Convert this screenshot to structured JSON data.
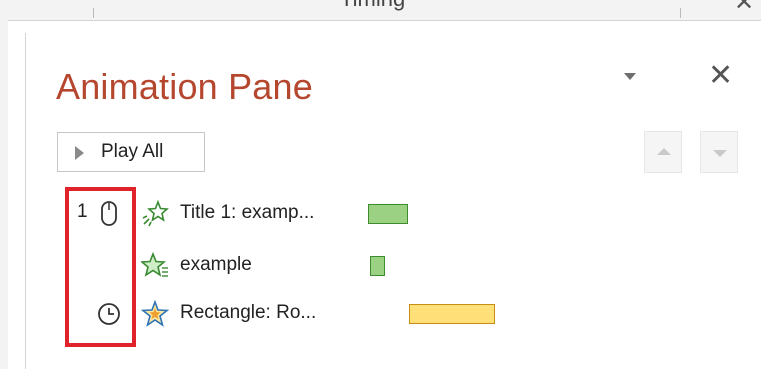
{
  "ribbon": {
    "tab_label": "Timing",
    "close_glyph": "✕"
  },
  "pane": {
    "title": "Animation Pane",
    "close_glyph": "✕",
    "play_all_label": "Play All"
  },
  "animations": [
    {
      "order": "1",
      "trigger": "mouse-click-icon",
      "effect": "entrance-star-icon",
      "name": "Title 1: examp...",
      "bar_color": "#9ad183"
    },
    {
      "order": "",
      "trigger": "",
      "effect": "entrance-text-star-icon",
      "name": "example",
      "bar_color": "#9ad183"
    },
    {
      "order": "",
      "trigger": "clock-icon",
      "effect": "emphasis-star-icon",
      "name": "Rectangle: Ro...",
      "bar_color": "#ffdf78"
    }
  ]
}
